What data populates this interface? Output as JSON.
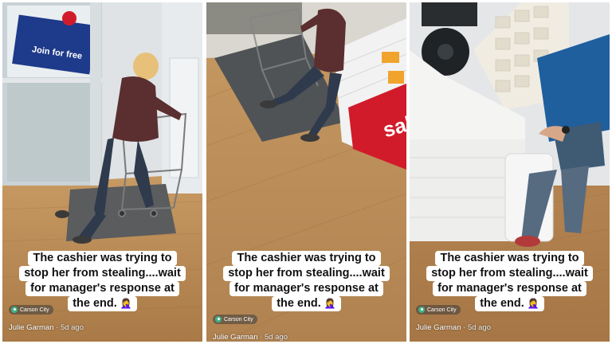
{
  "caption": {
    "line1": "The cashier was trying to",
    "line2": "stop her from stealing....wait",
    "line3": "for manager's response at",
    "line4": "the end.",
    "emoji": "🤦‍♀️"
  },
  "location": {
    "name": "Carson City",
    "icon": "location-pin-icon"
  },
  "author": {
    "name": "Julie Garman",
    "age": " · 5d ago"
  },
  "panel1": {
    "store_sign": "Join for free"
  },
  "panel2": {
    "store_sign": "sale"
  },
  "colors": {
    "floor": "#b98a57",
    "store_red": "#d11b2a",
    "sign_blue": "#1e3a8a",
    "caption_bg": "#ffffff"
  }
}
